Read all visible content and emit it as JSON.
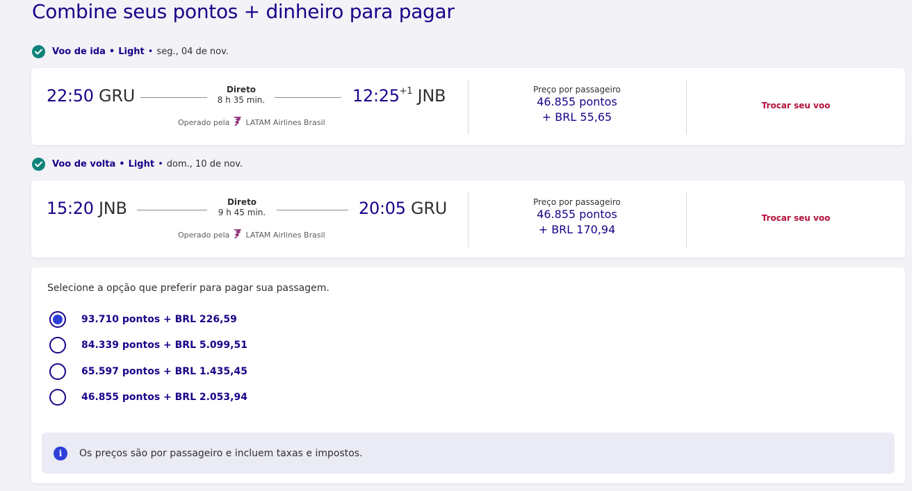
{
  "page": {
    "title": "Combine seus pontos + dinheiro para pagar"
  },
  "colors": {
    "brand": "#1b0088",
    "check": "#10837a",
    "link": "#b30f3b",
    "radio_fill": "#2e3fd8",
    "info_bg": "#ebebf5"
  },
  "outbound": {
    "header_type": "Voo de ida",
    "header_fare": "Light",
    "header_date": "seg., 04 de nov.",
    "dep_time": "22:50",
    "dep_code": "GRU",
    "stops": "Direto",
    "duration": "8 h 35 min.",
    "arr_time": "12:25",
    "arr_days": "+1",
    "arr_code": "JNB",
    "operated_label": "Operado pela",
    "operator": "LATAM Airlines Brasil",
    "price_label": "Preço por passageiro",
    "price_points": "46.855 pontos",
    "price_money": "+ BRL 55,65",
    "change_label": "Trocar seu voo"
  },
  "return": {
    "header_type": "Voo de volta",
    "header_fare": "Light",
    "header_date": "dom., 10 de nov.",
    "dep_time": "15:20",
    "dep_code": "JNB",
    "stops": "Direto",
    "duration": "9 h 45 min.",
    "arr_time": "20:05",
    "arr_code": "GRU",
    "operated_label": "Operado pela",
    "operator": "LATAM Airlines Brasil",
    "price_label": "Preço por passageiro",
    "price_points": "46.855 pontos",
    "price_money": "+ BRL 170,94",
    "change_label": "Trocar seu voo"
  },
  "payment": {
    "prompt": "Selecione a opção que preferir para pagar sua passagem.",
    "options": [
      {
        "label": "93.710 pontos + BRL 226,59",
        "selected": true
      },
      {
        "label": "84.339 pontos + BRL 5.099,51",
        "selected": false
      },
      {
        "label": "65.597 pontos + BRL 1.435,45",
        "selected": false
      },
      {
        "label": "46.855 pontos + BRL 2.053,94",
        "selected": false
      }
    ],
    "info_icon": "i",
    "info_text": "Os preços são por passageiro e incluem taxas e impostos."
  }
}
